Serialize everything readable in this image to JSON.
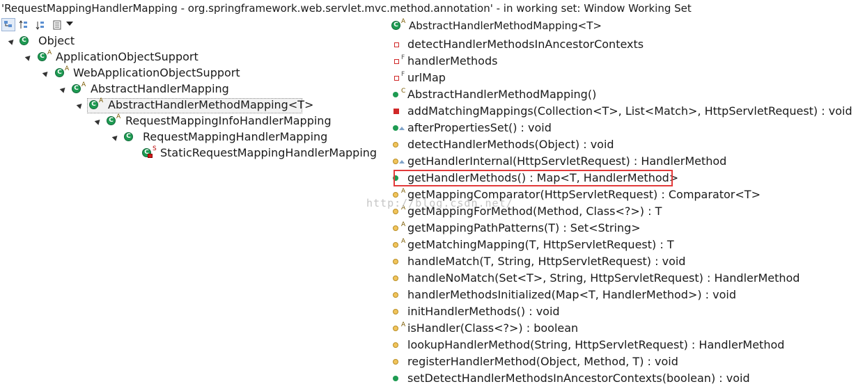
{
  "window": {
    "title": "'RequestMappingHandlerMapping - org.springframework.web.servlet.mvc.method.annotation' - in working set: Window Working Set"
  },
  "toolbar": {
    "buttons": [
      {
        "name": "show-type-hierarchy",
        "icon": "type-hierarchy-icon",
        "active": true
      },
      {
        "name": "show-supertype-hierarchy",
        "icon": "supertype-hierarchy-icon",
        "active": false
      },
      {
        "name": "show-subtype-hierarchy",
        "icon": "subtype-hierarchy-icon",
        "active": false
      },
      {
        "name": "history",
        "icon": "history-list-icon",
        "active": false
      }
    ]
  },
  "hierarchy": [
    {
      "label": "Object",
      "badge": "",
      "selected": false
    },
    {
      "label": "ApplicationObjectSupport",
      "badge": "A",
      "selected": false
    },
    {
      "label": "WebApplicationObjectSupport",
      "badge": "A",
      "selected": false
    },
    {
      "label": "AbstractHandlerMapping",
      "badge": "A",
      "selected": false
    },
    {
      "label": "AbstractHandlerMethodMapping<T>",
      "badge": "A",
      "selected": true
    },
    {
      "label": "RequestMappingInfoHandlerMapping",
      "badge": "A",
      "selected": false
    },
    {
      "label": "RequestMappingHandlerMapping",
      "badge": "",
      "selected": false
    },
    {
      "label": "StaticRequestMappingHandlerMapping",
      "badge": "S",
      "selected": false
    }
  ],
  "members_header": {
    "label": "AbstractHandlerMethodMapping<T>",
    "badge": "A"
  },
  "members": [
    {
      "label": "detectHandlerMethodsInAncestorContexts",
      "kind": "private-field",
      "badge": ""
    },
    {
      "label": "handlerMethods",
      "kind": "private-field",
      "badge": "F"
    },
    {
      "label": "urlMap",
      "kind": "private-field",
      "badge": "F"
    },
    {
      "label": "AbstractHandlerMethodMapping()",
      "kind": "public",
      "badge": "C"
    },
    {
      "label": "addMatchingMappings(Collection<T>, List<Match>, HttpServletRequest) : void",
      "kind": "private-method",
      "badge": ""
    },
    {
      "label": "afterPropertiesSet() : void",
      "kind": "public-override",
      "badge": ""
    },
    {
      "label": "detectHandlerMethods(Object) : void",
      "kind": "protected",
      "badge": ""
    },
    {
      "label": "getHandlerInternal(HttpServletRequest) : HandlerMethod",
      "kind": "protected-override",
      "badge": ""
    },
    {
      "label": "getHandlerMethods() : Map<T, HandlerMethod>",
      "kind": "public",
      "badge": ""
    },
    {
      "label": "getMappingComparator(HttpServletRequest) : Comparator<T>",
      "kind": "protected",
      "badge": "A"
    },
    {
      "label": "getMappingForMethod(Method, Class<?>) : T",
      "kind": "protected",
      "badge": "A"
    },
    {
      "label": "getMappingPathPatterns(T) : Set<String>",
      "kind": "protected",
      "badge": "A"
    },
    {
      "label": "getMatchingMapping(T, HttpServletRequest) : T",
      "kind": "protected",
      "badge": "A"
    },
    {
      "label": "handleMatch(T, String, HttpServletRequest) : void",
      "kind": "protected",
      "badge": ""
    },
    {
      "label": "handleNoMatch(Set<T>, String, HttpServletRequest) : HandlerMethod",
      "kind": "protected",
      "badge": ""
    },
    {
      "label": "handlerMethodsInitialized(Map<T, HandlerMethod>) : void",
      "kind": "protected",
      "badge": ""
    },
    {
      "label": "initHandlerMethods() : void",
      "kind": "protected",
      "badge": ""
    },
    {
      "label": "isHandler(Class<?>) : boolean",
      "kind": "protected",
      "badge": "A"
    },
    {
      "label": "lookupHandlerMethod(String, HttpServletRequest) : HandlerMethod",
      "kind": "protected",
      "badge": ""
    },
    {
      "label": "registerHandlerMethod(Object, Method, T) : void",
      "kind": "protected",
      "badge": ""
    },
    {
      "label": "setDetectHandlerMethodsInAncestorContexts(boolean) : void",
      "kind": "public",
      "badge": ""
    }
  ],
  "watermark": "http://blog.csdn.net/",
  "colors": {
    "class_icon": "#1e9b52",
    "highlight_box": "#e23b3b",
    "selection_bg": "#f2f2f2"
  }
}
